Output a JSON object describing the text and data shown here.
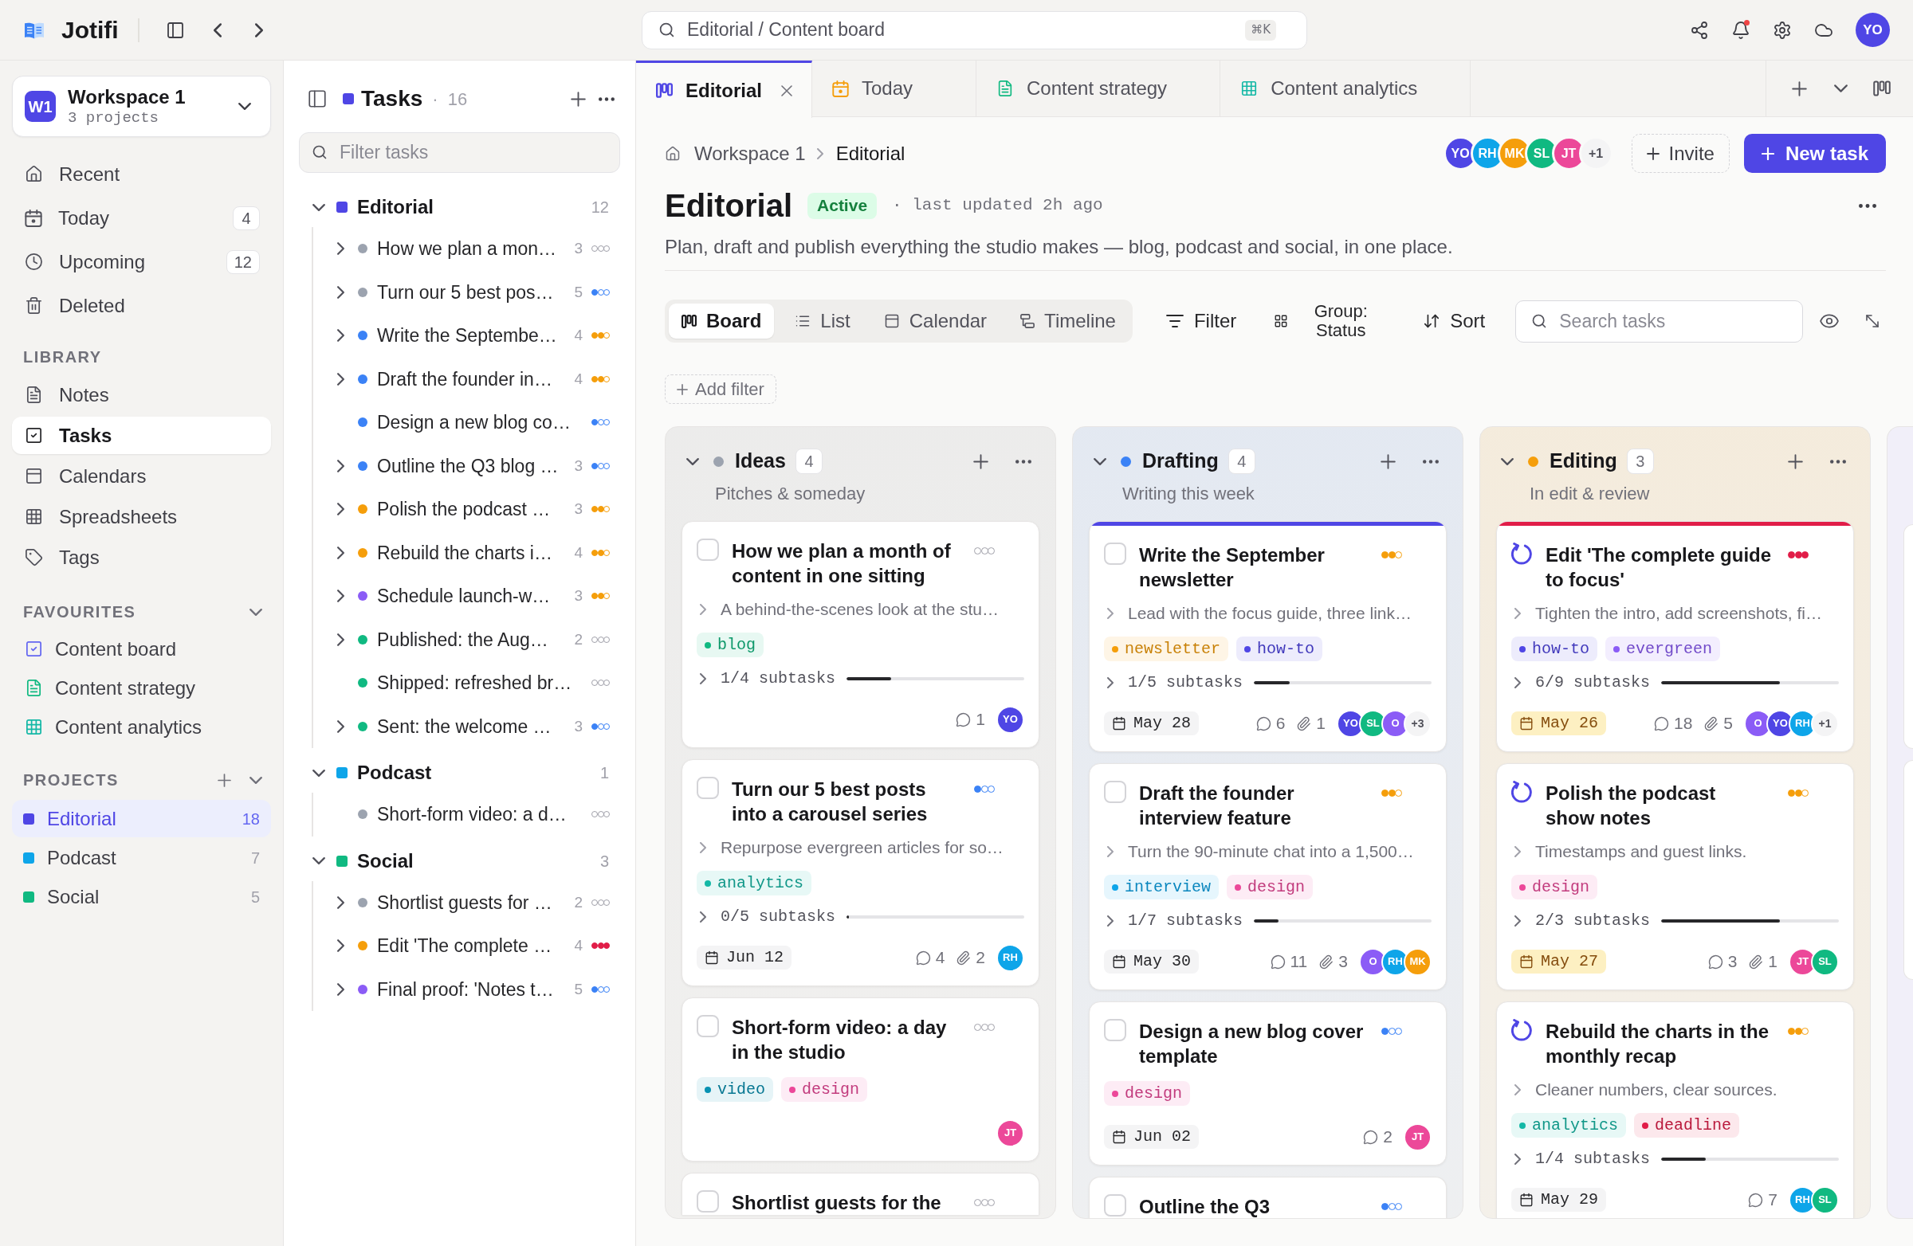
{
  "top_bar": {
    "app_name": "Jotifi",
    "search": {
      "label": "Editorial / Content board",
      "shortcut": "⌘K"
    },
    "notifications": {
      "unread": true
    },
    "user": {
      "initials": "YO",
      "color": "#4f46e5"
    }
  },
  "sidebar": {
    "workspace": {
      "badge": "W1",
      "name": "Workspace 1",
      "subtitle": "3 projects"
    },
    "nav": [
      {
        "label": "Recent",
        "selected": false
      },
      {
        "label": "Today",
        "count": "4",
        "selected": false
      },
      {
        "label": "Upcoming",
        "count": "12",
        "selected": false
      },
      {
        "label": "Deleted",
        "selected": false
      }
    ],
    "library": {
      "title": "LIBRARY",
      "items": [
        {
          "label": "Notes",
          "selected": false
        },
        {
          "label": "Tasks",
          "selected": true
        },
        {
          "label": "Calendars",
          "selected": false
        },
        {
          "label": "Spreadsheets",
          "selected": false
        },
        {
          "label": "Tags",
          "selected": false
        }
      ]
    },
    "favourites": {
      "title": "FAVOURITES",
      "expanded": true,
      "items": [
        {
          "label": "Content board",
          "selected": false
        },
        {
          "label": "Content strategy",
          "selected": false
        },
        {
          "label": "Content analytics",
          "selected": false
        }
      ]
    },
    "projects": {
      "title": "PROJECTS",
      "expanded": true,
      "items": [
        {
          "label": "Editorial",
          "count": "18",
          "color": "#4f46e5",
          "selected": true
        },
        {
          "label": "Podcast",
          "count": "7",
          "color": "#0ea5e9",
          "selected": false
        },
        {
          "label": "Social",
          "count": "5",
          "color": "#10b981",
          "selected": false
        }
      ]
    }
  },
  "tasks_panel": {
    "title": "Tasks",
    "separator": "·",
    "count": "16",
    "filter": {
      "placeholder": "Filter tasks"
    },
    "groups": [
      {
        "name": "Editorial",
        "count": "12",
        "color": "#4f46e5",
        "expanded": true,
        "items": [
          {
            "title": "How we plan a mon…",
            "color": "#9ca3af",
            "count": "3",
            "expandable": true,
            "stars": 0
          },
          {
            "title": "Turn our 5 best pos…",
            "color": "#9ca3af",
            "count": "5",
            "expandable": true,
            "stars": 1
          },
          {
            "title": "Write the Septembe…",
            "color": "#3b82f6",
            "count": "4",
            "expandable": true,
            "stars": 2
          },
          {
            "title": "Draft the founder in…",
            "color": "#3b82f6",
            "count": "4",
            "expandable": true,
            "stars": 2
          },
          {
            "title": "Design a new blog co…",
            "color": "#3b82f6",
            "expandable": false,
            "stars": 1
          },
          {
            "title": "Outline the Q3 blog …",
            "color": "#3b82f6",
            "count": "3",
            "expandable": true,
            "stars": 1
          },
          {
            "title": "Polish the podcast …",
            "color": "#f59e0b",
            "count": "3",
            "expandable": true,
            "stars": 2
          },
          {
            "title": "Rebuild the charts i…",
            "color": "#f59e0b",
            "count": "4",
            "expandable": true,
            "stars": 2
          },
          {
            "title": "Schedule launch-w…",
            "color": "#8b5cf6",
            "count": "3",
            "expandable": true,
            "stars": 2
          },
          {
            "title": "Published: the Aug…",
            "color": "#10b981",
            "count": "2",
            "expandable": true,
            "stars": 0
          },
          {
            "title": "Shipped: refreshed br…",
            "color": "#10b981",
            "expandable": false,
            "stars": 0
          },
          {
            "title": "Sent: the welcome …",
            "color": "#10b981",
            "count": "3",
            "expandable": true,
            "stars": 1
          }
        ]
      },
      {
        "name": "Podcast",
        "count": "1",
        "color": "#0ea5e9",
        "expanded": true,
        "items": [
          {
            "title": "Short-form video: a d…",
            "color": "#9ca3af",
            "expandable": false,
            "stars": 0
          }
        ]
      },
      {
        "name": "Social",
        "count": "3",
        "color": "#10b981",
        "expanded": true,
        "items": [
          {
            "title": "Shortlist guests for …",
            "color": "#9ca3af",
            "count": "2",
            "expandable": true,
            "stars": 0
          },
          {
            "title": "Edit 'The complete …",
            "color": "#f59e0b",
            "count": "4",
            "expandable": true,
            "stars": 3
          },
          {
            "title": "Final proof: 'Notes t…",
            "color": "#8b5cf6",
            "count": "5",
            "expandable": true,
            "stars": 1
          }
        ]
      }
    ]
  },
  "tabs": [
    {
      "label": "Editorial",
      "selected": true
    },
    {
      "label": "Today",
      "selected": false
    },
    {
      "label": "Content strategy",
      "selected": false
    },
    {
      "label": "Content analytics",
      "selected": false
    }
  ],
  "page": {
    "breadcrumb": [
      "Workspace 1",
      "Editorial"
    ],
    "members": [
      {
        "initials": "YO",
        "color": "#4f46e5"
      },
      {
        "initials": "RH",
        "color": "#0ea5e9"
      },
      {
        "initials": "MK",
        "color": "#f59e0b"
      },
      {
        "initials": "SL",
        "color": "#10b981"
      },
      {
        "initials": "JT",
        "color": "#ec4899"
      }
    ],
    "members_more": "+1",
    "invite": "Invite",
    "new_task": "New task",
    "title": "Editorial",
    "status": "Active",
    "updated": "· last updated 2h ago",
    "description": "Plan, draft and publish everything the studio makes — blog, podcast and social, in one place."
  },
  "toolbar": {
    "views": [
      {
        "label": "Board",
        "selected": true
      },
      {
        "label": "List",
        "selected": false
      },
      {
        "label": "Calendar",
        "selected": false
      },
      {
        "label": "Timeline",
        "selected": false
      }
    ],
    "filter": "Filter",
    "group": "Group: Status",
    "sort": "Sort",
    "search": {
      "placeholder": "Search tasks"
    },
    "add_filter": "Add filter"
  },
  "board": {
    "columns": [
      {
        "title": "Ideas",
        "count": "4",
        "subtitle": "Pitches & someday",
        "color": "#9ca3af",
        "cards": [
          {
            "kind": "todo",
            "checked": false,
            "title": "How we plan a month of\ncontent in one sitting",
            "stars": 0,
            "description": "A behind-the-scenes look at the stu…",
            "tags": [
              {
                "label": "blog",
                "color": "#10b981"
              }
            ],
            "subtasks": {
              "label": "1/4 subtasks",
              "level": 0.25
            },
            "comments": "1",
            "assignees": [
              {
                "initials": "YO",
                "color": "#4f46e5"
              }
            ]
          },
          {
            "kind": "todo",
            "checked": false,
            "title": "Turn our 5 best posts\ninto a carousel series",
            "stars": 1,
            "description": "Repurpose evergreen articles for so…",
            "tags": [
              {
                "label": "analytics",
                "color": "#14b8a6"
              }
            ],
            "subtasks": {
              "label": "0/5 subtasks",
              "level": 0
            },
            "due": {
              "label": "Jun 12",
              "due_soon": false
            },
            "comments": "4",
            "attachments": "2",
            "assignees": [
              {
                "initials": "RH",
                "color": "#0ea5e9"
              }
            ]
          },
          {
            "kind": "todo",
            "checked": false,
            "title": "Short-form video: a day\nin the studio",
            "stars": 0,
            "tags": [
              {
                "label": "video",
                "color": "#0891b2"
              },
              {
                "label": "design",
                "color": "#ec4899"
              }
            ],
            "assignees": [
              {
                "initials": "JT",
                "color": "#ec4899"
              }
            ]
          },
          {
            "kind": "todo",
            "checked": false,
            "title": "Shortlist guests for the",
            "stars": 0
          }
        ]
      },
      {
        "title": "Drafting",
        "count": "4",
        "subtitle": "Writing this week",
        "color": "#3b82f6",
        "cards": [
          {
            "kind": "todo",
            "checked": false,
            "color": "#4f46e5",
            "title": "Write the September\nnewsletter",
            "stars": 2,
            "description": "Lead with the focus guide, three link…",
            "tags": [
              {
                "label": "newsletter",
                "color": "#f59e0b"
              },
              {
                "label": "how-to",
                "color": "#4f46e5"
              }
            ],
            "subtasks": {
              "label": "1/5 subtasks",
              "level": 0.2
            },
            "due": {
              "label": "May 28",
              "due_soon": false
            },
            "comments": "6",
            "attachments": "1",
            "assignees": [
              {
                "initials": "YO",
                "color": "#4f46e5"
              },
              {
                "initials": "SL",
                "color": "#10b981"
              },
              {
                "initials": "O",
                "color": "#8b5cf6"
              }
            ],
            "assignees_more": "+3"
          },
          {
            "kind": "todo",
            "checked": false,
            "title": "Draft the founder\ninterview feature",
            "stars": 2,
            "description": "Turn the 90-minute chat into a 1,500…",
            "tags": [
              {
                "label": "interview",
                "color": "#0ea5e9"
              },
              {
                "label": "design",
                "color": "#ec4899"
              }
            ],
            "subtasks": {
              "label": "1/7 subtasks",
              "level": 0.14
            },
            "due": {
              "label": "May 30",
              "due_soon": false
            },
            "comments": "11",
            "attachments": "3",
            "assignees": [
              {
                "initials": "O",
                "color": "#8b5cf6"
              },
              {
                "initials": "RH",
                "color": "#0ea5e9"
              },
              {
                "initials": "MK",
                "color": "#f59e0b"
              }
            ]
          },
          {
            "kind": "todo",
            "checked": false,
            "title": "Design a new blog cover\ntemplate",
            "stars": 1,
            "tags": [
              {
                "label": "design",
                "color": "#ec4899"
              }
            ],
            "due": {
              "label": "Jun 02",
              "due_soon": false
            },
            "comments": "2",
            "assignees": [
              {
                "initials": "JT",
                "color": "#ec4899"
              }
            ]
          },
          {
            "kind": "todo",
            "checked": false,
            "title": "Outline the Q3",
            "stars": 1
          }
        ]
      },
      {
        "title": "Editing",
        "count": "3",
        "subtitle": "In edit & review",
        "color": "#f59e0b",
        "cards": [
          {
            "kind": "in_progress",
            "color": "#e11d48",
            "title": "Edit 'The complete guide\nto focus'",
            "stars": 3,
            "description": "Tighten the intro, add screenshots, fi…",
            "tags": [
              {
                "label": "how-to",
                "color": "#4f46e5"
              },
              {
                "label": "evergreen",
                "color": "#8b5cf6"
              }
            ],
            "subtasks": {
              "label": "6/9 subtasks",
              "level": 0.667
            },
            "due": {
              "label": "May 26",
              "due_soon": true
            },
            "comments": "18",
            "attachments": "5",
            "assignees": [
              {
                "initials": "O",
                "color": "#8b5cf6"
              },
              {
                "initials": "YO",
                "color": "#4f46e5"
              },
              {
                "initials": "RH",
                "color": "#0ea5e9"
              }
            ],
            "assignees_more": "+1"
          },
          {
            "kind": "in_progress",
            "title": "Polish the podcast\nshow notes",
            "stars": 2,
            "description": "Timestamps and guest links.",
            "tags": [
              {
                "label": "design",
                "color": "#ec4899"
              }
            ],
            "subtasks": {
              "label": "2/3 subtasks",
              "level": 0.667
            },
            "due": {
              "label": "May 27",
              "due_soon": true
            },
            "comments": "3",
            "attachments": "1",
            "assignees": [
              {
                "initials": "JT",
                "color": "#ec4899"
              },
              {
                "initials": "SL",
                "color": "#10b981"
              }
            ]
          },
          {
            "kind": "in_progress",
            "title": "Rebuild the charts in the\nmonthly recap",
            "stars": 2,
            "description": "Cleaner numbers, clear sources.",
            "tags": [
              {
                "label": "analytics",
                "color": "#14b8a6"
              },
              {
                "label": "deadline",
                "color": "#e11d48"
              }
            ],
            "subtasks": {
              "label": "1/4 subtasks",
              "level": 0.25
            },
            "due": {
              "label": "May 29",
              "due_soon": false
            },
            "comments": "7",
            "assignees": [
              {
                "initials": "RH",
                "color": "#0ea5e9"
              },
              {
                "initials": "SL",
                "color": "#10b981"
              }
            ]
          }
        ]
      }
    ]
  }
}
